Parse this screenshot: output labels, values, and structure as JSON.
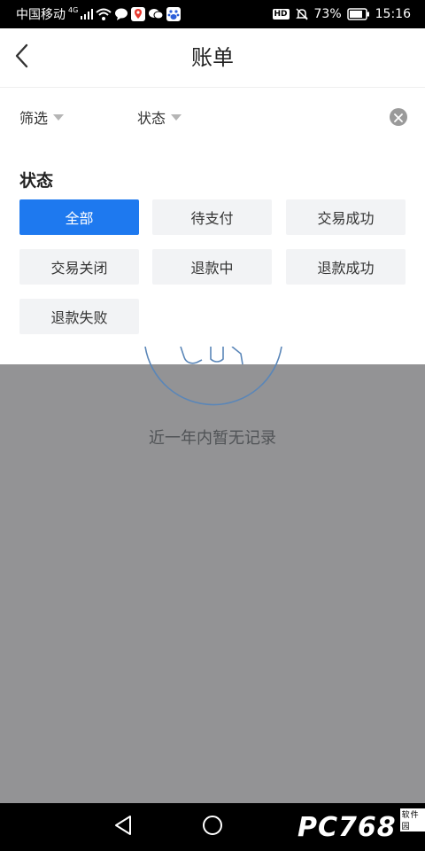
{
  "status_bar": {
    "carrier": "中国移动",
    "network_type": "4G",
    "battery_percent": "73%",
    "time": "15:16",
    "hd_label": "HD"
  },
  "header": {
    "title": "账单"
  },
  "filter_bar": {
    "filter_label": "筛选",
    "status_label": "状态"
  },
  "status_panel": {
    "title": "状态",
    "options": [
      {
        "label": "全部",
        "selected": true
      },
      {
        "label": "待支付",
        "selected": false
      },
      {
        "label": "交易成功",
        "selected": false
      },
      {
        "label": "交易关闭",
        "selected": false
      },
      {
        "label": "退款中",
        "selected": false
      },
      {
        "label": "退款成功",
        "selected": false
      },
      {
        "label": "退款失败",
        "selected": false
      }
    ]
  },
  "empty_state": {
    "message": "近一年内暂无记录"
  },
  "watermark": {
    "text": "PC768",
    "sub": "软件园"
  },
  "colors": {
    "accent": "#1e79ef",
    "overlay": "#939395",
    "chip_bg": "#f2f3f5",
    "illustration_stroke": "#5a86b8"
  }
}
